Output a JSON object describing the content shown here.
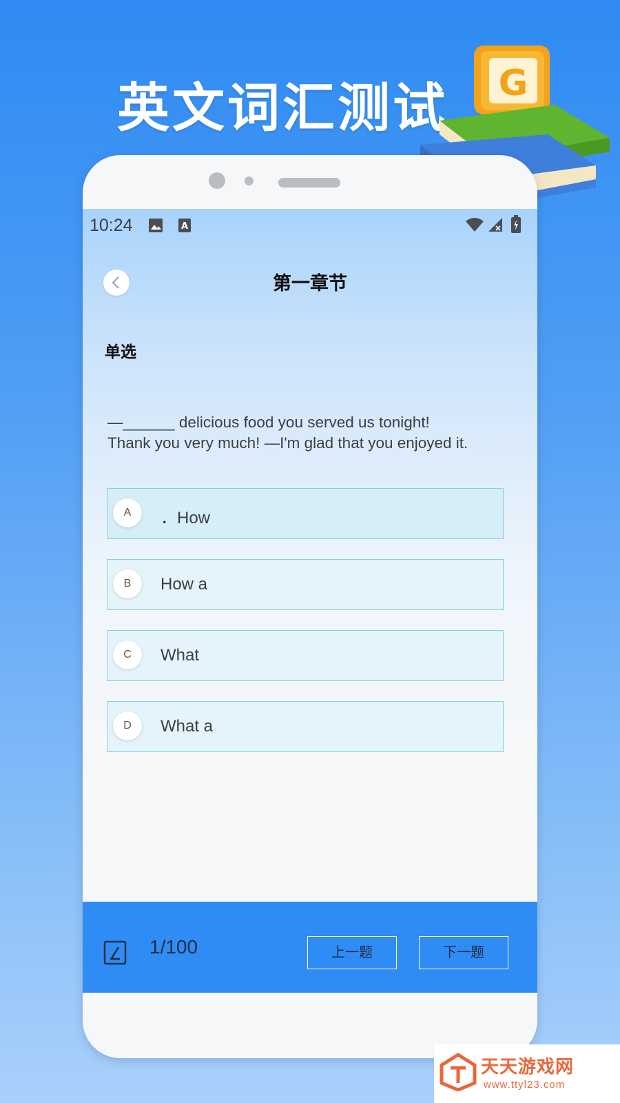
{
  "promo": {
    "title": "英文词汇测试"
  },
  "status_bar": {
    "time": "10:24"
  },
  "nav": {
    "title": "第一章节"
  },
  "question": {
    "type_label": "单选",
    "line1": "—______ delicious food you served us tonight!",
    "line2": "Thank you very much! —I'm glad that you enjoyed it."
  },
  "options": [
    {
      "letter": "A",
      "text": "．How"
    },
    {
      "letter": "B",
      "text": "How a"
    },
    {
      "letter": "C",
      "text": "What"
    },
    {
      "letter": "D",
      "text": "What a"
    }
  ],
  "footer": {
    "progress": "1/100",
    "prev_label": "上一题",
    "next_label": "下一题"
  },
  "watermark": {
    "name": "天天游戏网",
    "url": "www.ttyl23.com"
  },
  "colors": {
    "accent": "#2f8cf5",
    "option_border": "#7fd4dc",
    "option_bg": "#e4f4fa"
  }
}
